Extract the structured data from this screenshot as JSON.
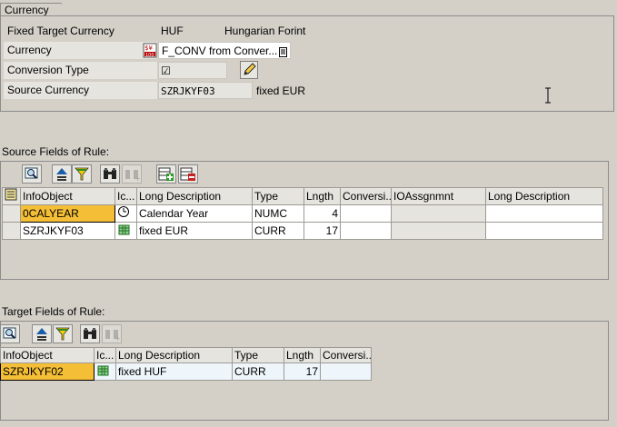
{
  "currency_group": {
    "title": "Currency",
    "rows": [
      {
        "label": "Fixed Target Currency",
        "value": "HUF",
        "description": "Hungarian Forint"
      },
      {
        "label": "Currency",
        "value": "F_CONV from Conver..."
      },
      {
        "label": "Conversion Type",
        "value": "☑"
      },
      {
        "label": "Source Currency",
        "value": "SZRJKYF03",
        "description": "fixed EUR"
      }
    ]
  },
  "source_section": {
    "title": "Source Fields of Rule:",
    "columns": [
      "InfoObject",
      "Ic...",
      "Long Description",
      "Type",
      "Lngth",
      "Conversi...",
      "IOAssgnmnt",
      "Long Description"
    ],
    "rows": [
      {
        "infoobject": "0CALYEAR",
        "icon": "clock-icon",
        "description": "Calendar Year",
        "type": "NUMC",
        "length": "4",
        "conversion": "",
        "ioassignment": "",
        "long_description": ""
      },
      {
        "infoobject": "SZRJKYF03",
        "icon": "keyfigure-icon",
        "description": "fixed EUR",
        "type": "CURR",
        "length": "17",
        "conversion": "",
        "ioassignment": "",
        "long_description": ""
      }
    ]
  },
  "target_section": {
    "title": "Target Fields of Rule:",
    "columns": [
      "InfoObject",
      "Ic...",
      "Long Description",
      "Type",
      "Lngth",
      "Conversi..."
    ],
    "rows": [
      {
        "infoobject": "SZRJKYF02",
        "icon": "keyfigure-icon",
        "description": "fixed HUF",
        "type": "CURR",
        "length": "17",
        "conversion": ""
      }
    ]
  },
  "colors": {
    "background": "#d4d0c8",
    "key_cell": "#f4be37",
    "target_row": "#eef6fc"
  }
}
